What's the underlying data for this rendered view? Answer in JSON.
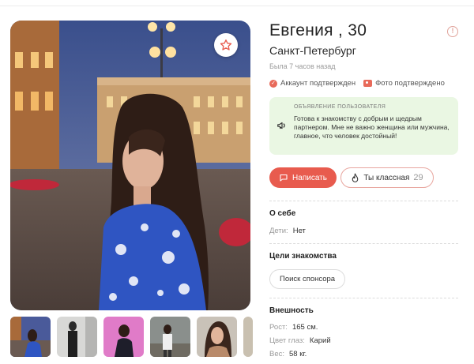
{
  "profile": {
    "name": "Евгения , 30",
    "city": "Санкт-Петербург",
    "last_seen": "Была 7 часов назад"
  },
  "badges": {
    "account": "Аккаунт подтвержден",
    "photo": "Фото подтверждено"
  },
  "ad": {
    "title": "Объявление пользователя",
    "text": "Готова к знакомству с добрым и щедрым партнером. Мне не важно женщина или мужчина, главное, что человек достойный!"
  },
  "actions": {
    "write_label": "Написать",
    "cool_label": "Ты классная",
    "cool_count": "29"
  },
  "about": {
    "title": "О себе",
    "children_label": "Дети:",
    "children_value": "Нет"
  },
  "goals": {
    "title": "Цели знакомства",
    "chip": "Поиск спонсора"
  },
  "appearance": {
    "title": "Внешность",
    "height_label": "Рост:",
    "height_value": "165 см.",
    "eyes_label": "Цвет глаз:",
    "eyes_value": "Карий",
    "weight_label": "Вес:",
    "weight_value": "58 кг."
  },
  "colors": {
    "accent": "#e85b4e",
    "ad_bg": "#eaf7e3"
  },
  "icons": [
    "star-icon",
    "info-icon",
    "check-icon",
    "camera-icon",
    "megaphone-icon",
    "chat-icon",
    "fire-icon"
  ]
}
